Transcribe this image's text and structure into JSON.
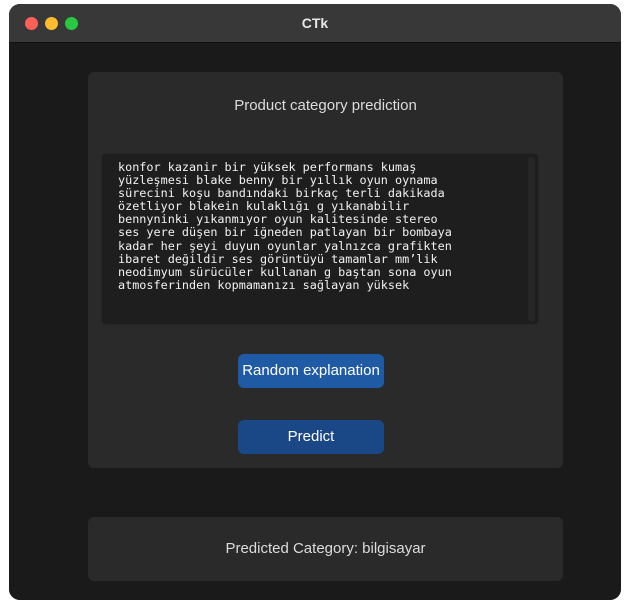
{
  "window": {
    "title": "CTk"
  },
  "card": {
    "title": "Product category prediction",
    "description_text": "konfor kazanir bir yüksek performans kumaş\nyüzleşmesi blake benny bir yıllık oyun oynama\nsürecini koşu bandındaki birkaç terli dakikada\nözetliyor blakein kulaklığı g yıkanabilir\nbennyninki yıkanmıyor oyun kalitesinde stereo\nses yere düşen bir iğneden patlayan bir bombaya\nkadar her şeyi duyun oyunlar yalnızca grafikten\nibaret değildir ses görüntüyü tamamlar mm’lik\nneodimyum sürücüler kullanan g baştan sona oyun\natmosferinden kopmamanızı sağlayan yüksek"
  },
  "buttons": {
    "random_label": "Random explanation",
    "predict_label": "Predict"
  },
  "result": {
    "text": "Predicted Category: bilgisayar"
  },
  "colors": {
    "accent_primary": "#1f5aa5",
    "accent_secondary": "#1a4886",
    "traffic_close": "#fe5f57",
    "traffic_minimize": "#febc2e",
    "traffic_maximize": "#28c840"
  }
}
